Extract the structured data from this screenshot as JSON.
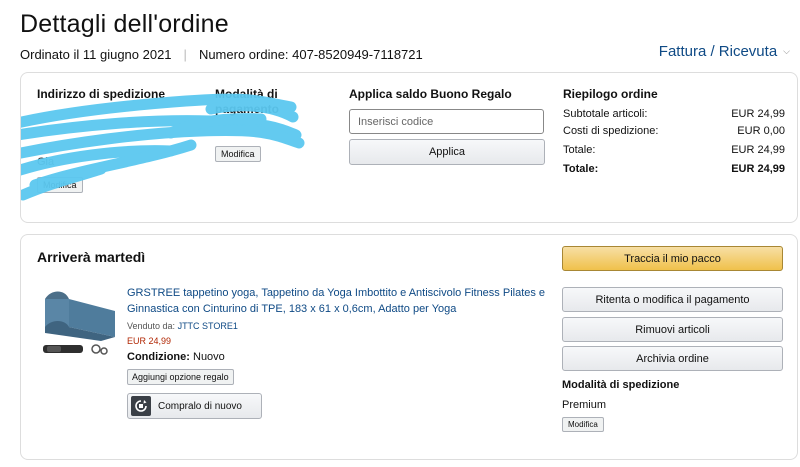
{
  "header": {
    "title": "Dettagli dell'ordine",
    "ordered_on": "Ordinato il 11 giugno 2021",
    "order_number": "Numero ordine: 407-8520949-7118721",
    "invoice_label": "Fattura / Ricevuta"
  },
  "shipping_address": {
    "title": "Indirizzo di spedizione",
    "line_1": "Gia",
    "modify_label": "Modifica"
  },
  "payment": {
    "title_line1": "Modalità di",
    "title_line2": "pagamento",
    "modify_label": "Modifica"
  },
  "gift": {
    "title": "Applica saldo Buono Regalo",
    "placeholder": "Inserisci codice",
    "apply_label": "Applica"
  },
  "summary": {
    "title": "Riepilogo ordine",
    "rows": [
      {
        "label": "Subtotale articoli:",
        "value": "EUR 24,99"
      },
      {
        "label": "Costi di spedizione:",
        "value": "EUR 0,00"
      },
      {
        "label": "Totale:",
        "value": "EUR 24,99"
      },
      {
        "label": "Totale:",
        "value": "EUR 24,99"
      }
    ]
  },
  "shipment": {
    "arrival": "Arriverà martedì",
    "product_title": "GRSTREE tappetino yoga, Tappetino da Yoga Imbottito e Antiscivolo Fitness Pilates e Ginnastica con Cinturino di TPE, 183 x 61 x 0,6cm, Adatto per Yoga",
    "sold_by_label": "Venduto da:",
    "seller": "JTTC STORE1",
    "price": "EUR 24,99",
    "condition_label": "Condizione:",
    "condition_value": "Nuovo",
    "gift_option_label": "Aggiungi opzione regalo",
    "buy_again_label": "Compralo di nuovo"
  },
  "actions": {
    "track": "Traccia il mio pacco",
    "change_payment": "Ritenta o modifica il pagamento",
    "remove_items": "Rimuovi articoli",
    "archive": "Archivia ordine"
  },
  "shipping_method": {
    "title": "Modalità di spedizione",
    "value": "Premium",
    "modify_label": "Modifica"
  },
  "colors": {
    "link": "#0f4a85",
    "price": "#b12704",
    "primary_button": "#f0c14b",
    "scribble": "#5bc8f0"
  }
}
